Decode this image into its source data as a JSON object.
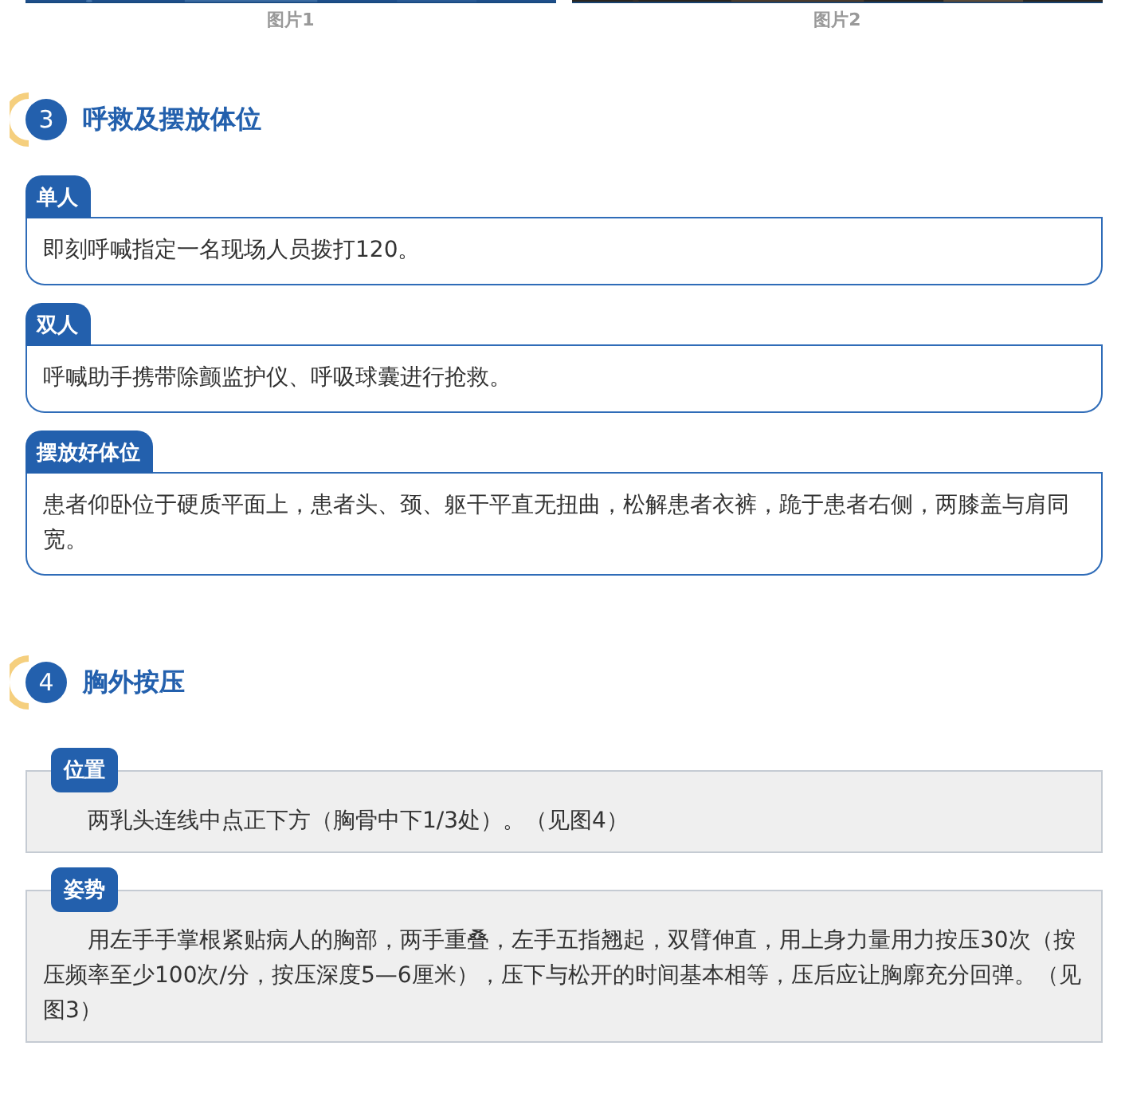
{
  "figures": [
    {
      "kind": "picture",
      "caption": "图片1"
    },
    {
      "kind": "picture",
      "caption": "图片2"
    }
  ],
  "sections": [
    {
      "number": "3",
      "title": "呼救及摆放体位",
      "kind": "card",
      "items": [
        {
          "label": "单人",
          "text": "即刻呼喊指定一名现场人员拨打120。"
        },
        {
          "label": "双人",
          "text": "呼喊助手携带除颤监护仪、呼吸球囊进行抢救。"
        },
        {
          "label": "摆放好体位",
          "text": "患者仰卧位于硬质平面上，患者头、颈、躯干平直无扭曲，松解患者衣裤，跪于患者右侧，两膝盖与肩同宽。"
        }
      ]
    },
    {
      "number": "4",
      "title": "胸外按压",
      "kind": "note",
      "items": [
        {
          "label": "位置",
          "text": "两乳头连线中点正下方（胸骨中下1/3处）。（见图4）"
        },
        {
          "label": "姿势",
          "text": "用左手手掌根紧贴病人的胸部，两手重叠，左手五指翘起，双臂伸直，用上身力量用力按压30次（按压频率至少100次/分，按压深度5—6厘米），压下与松开的时间基本相等，压后应让胸廓充分回弹。（见图3）"
        }
      ]
    }
  ]
}
